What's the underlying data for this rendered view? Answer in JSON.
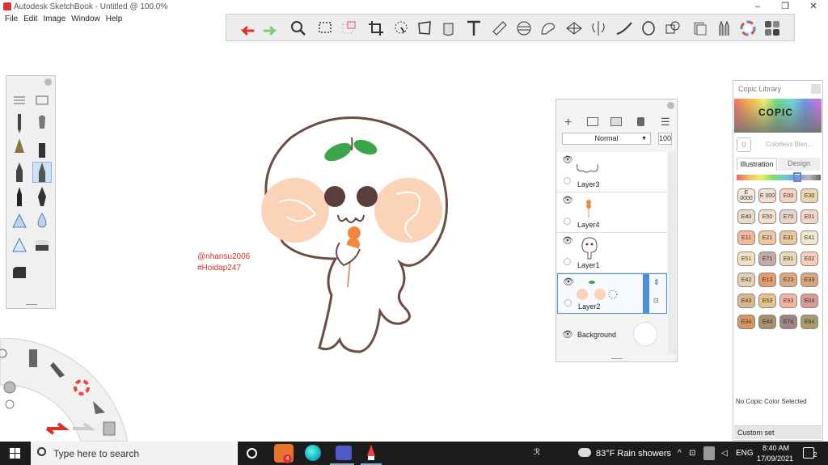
{
  "window": {
    "title": "Autodesk SketchBook - Untitled @ 100.0%",
    "controls": [
      "–",
      "❐",
      "✕"
    ]
  },
  "menu": [
    "File",
    "Edit",
    "Image",
    "Window",
    "Help"
  ],
  "toolbar": {
    "icons": [
      "undo-icon",
      "redo-icon",
      "zoom-icon",
      "select-icon",
      "transform-icon",
      "crop-icon",
      "lasso-icon",
      "distort-icon",
      "bucket-icon",
      "text-icon",
      "ruler-icon",
      "ellipse-guide-icon",
      "french-curve-icon",
      "perspective-icon",
      "symmetry-icon",
      "stroke-icon",
      "shape-icon",
      "copy-paste-icon",
      "layer-icon",
      "brush-library-icon",
      "color-wheel-icon",
      "copic-icon"
    ]
  },
  "watermark": {
    "line1": "@nhansu2006",
    "line2": "#Hoidap247"
  },
  "layers": {
    "blend_mode": "Normal",
    "opacity": "100",
    "items": [
      {
        "name": "Layer3"
      },
      {
        "name": "Layer4"
      },
      {
        "name": "Layer1"
      },
      {
        "name": "Layer2"
      }
    ],
    "background_label": "Background"
  },
  "copic": {
    "title": "Copic Library",
    "colorless_label": "Colorless Blen...",
    "colorless_code": "0",
    "tabs": [
      "Illustration",
      "Design"
    ],
    "no_color": "No Copic Color Selected",
    "custom_set": "Custom set",
    "swatches": [
      {
        "code": "E 0000",
        "color": "#f6e9dc"
      },
      {
        "code": "E 000",
        "color": "#f4e2d0"
      },
      {
        "code": "E00",
        "color": "#f5d5bf"
      },
      {
        "code": "E30",
        "color": "#ecd6b0"
      },
      {
        "code": "E40",
        "color": "#e9ddc8"
      },
      {
        "code": "E50",
        "color": "#eee2cf"
      },
      {
        "code": "E70",
        "color": "#e8d6cc"
      },
      {
        "code": "E01",
        "color": "#f6d7c7"
      },
      {
        "code": "E11",
        "color": "#f5b999"
      },
      {
        "code": "E21",
        "color": "#f0c7a3"
      },
      {
        "code": "E31",
        "color": "#e9c69b"
      },
      {
        "code": "E41",
        "color": "#f2e7cc"
      },
      {
        "code": "E51",
        "color": "#f3e1c0"
      },
      {
        "code": "E71",
        "color": "#c8aaa5"
      },
      {
        "code": "E81",
        "color": "#ead9b9"
      },
      {
        "code": "E02",
        "color": "#f7ceba"
      },
      {
        "code": "E42",
        "color": "#e2d0b0"
      },
      {
        "code": "E13",
        "color": "#e69a6d"
      },
      {
        "code": "E23",
        "color": "#dfa77d"
      },
      {
        "code": "E33",
        "color": "#dba57a"
      },
      {
        "code": "E43",
        "color": "#d8b88c"
      },
      {
        "code": "E53",
        "color": "#e7c28d"
      },
      {
        "code": "E93",
        "color": "#f5b4a4"
      },
      {
        "code": "E04",
        "color": "#d99b97"
      },
      {
        "code": "E34",
        "color": "#d9955f"
      },
      {
        "code": "E44",
        "color": "#a79070"
      },
      {
        "code": "E74",
        "color": "#9c8582"
      },
      {
        "code": "E84",
        "color": "#a99a6d"
      }
    ]
  },
  "taskbar": {
    "search_placeholder": "Type here to search",
    "weather": "83°F  Rain showers",
    "lang": "ENG",
    "time": "8:40 AM",
    "date": "17/09/2021",
    "notif_count": "2",
    "badge": "4"
  }
}
